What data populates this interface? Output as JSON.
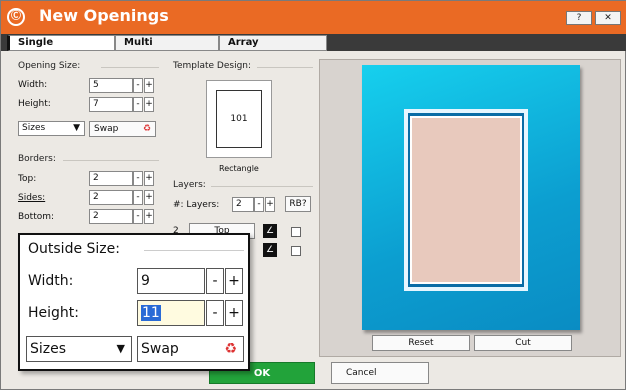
{
  "window": {
    "title": "New Openings",
    "logo": "Ⓒ",
    "help_icon": "help-icon",
    "close_icon": "close-icon"
  },
  "tabs": [
    {
      "label": "Single"
    },
    {
      "label": "Multi"
    },
    {
      "label": "Array"
    }
  ],
  "opening_size": {
    "title": "Opening Size:",
    "width_label": "Width:",
    "width_value": "5",
    "height_label": "Height:",
    "height_value": "7"
  },
  "sizes_label": "Sizes",
  "swap_label": "Swap",
  "borders": {
    "title": "Borders:",
    "top_label": "Top:",
    "top_value": "2",
    "sides_label": "Sides:",
    "sides_value": "2",
    "bottom_label": "Bottom:",
    "bottom_value": "2"
  },
  "template": {
    "title": "Template Design:",
    "number": "101",
    "name": "Rectangle"
  },
  "layers": {
    "title": "Layers:",
    "count_label": "#: Layers:",
    "count_value": "2",
    "rb_label": "RB?",
    "row_index": "2",
    "row_name": "Top"
  },
  "stepper": {
    "minus": "-",
    "plus": "+"
  },
  "outside_size": {
    "title": "Outside Size:",
    "width_label": "Width:",
    "width_value": "9",
    "height_label": "Height:",
    "height_value": "11"
  },
  "buttons": {
    "reset": "Reset",
    "cut": "Cut",
    "ok": "OK",
    "cancel": "Cancel"
  },
  "colors": {
    "titlebar": "#ea6a24",
    "mat": "#0c9ed0",
    "ok": "#22a33a"
  }
}
